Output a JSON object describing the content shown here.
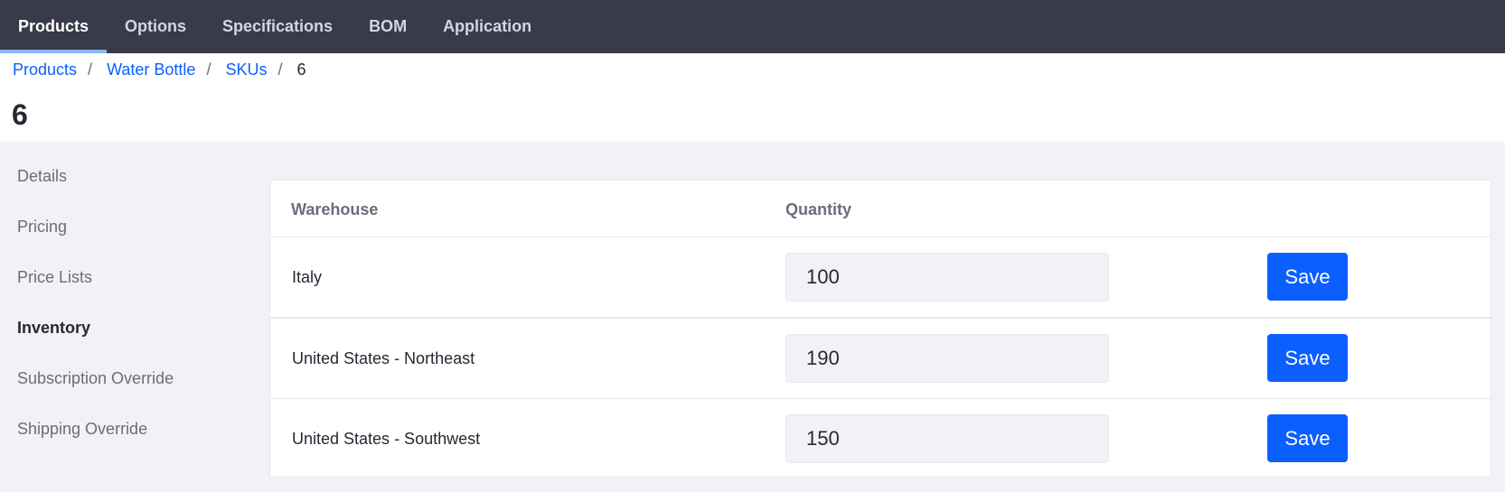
{
  "topnav": {
    "tabs": [
      {
        "label": "Products",
        "active": true
      },
      {
        "label": "Options",
        "active": false
      },
      {
        "label": "Specifications",
        "active": false
      },
      {
        "label": "BOM",
        "active": false
      },
      {
        "label": "Application",
        "active": false
      }
    ]
  },
  "breadcrumb": {
    "items": [
      "Products",
      "Water Bottle",
      "SKUs"
    ],
    "separator": "/",
    "current": "6"
  },
  "page": {
    "title": "6"
  },
  "sidenav": {
    "items": [
      {
        "label": "Details",
        "active": false
      },
      {
        "label": "Pricing",
        "active": false
      },
      {
        "label": "Price Lists",
        "active": false
      },
      {
        "label": "Inventory",
        "active": true
      },
      {
        "label": "Subscription Override",
        "active": false
      },
      {
        "label": "Shipping Override",
        "active": false
      }
    ]
  },
  "inventory": {
    "columns": {
      "warehouse": "Warehouse",
      "quantity": "Quantity"
    },
    "rows": [
      {
        "warehouse": "Italy",
        "quantity": "100",
        "action": "Save"
      },
      {
        "warehouse": "United States - Northeast",
        "quantity": "190",
        "action": "Save"
      },
      {
        "warehouse": "United States - Southwest",
        "quantity": "150",
        "action": "Save"
      }
    ]
  },
  "colors": {
    "topnav_bg": "#393a4a",
    "accent": "#0b5fff",
    "active_tab_indicator": "#8ab4f8",
    "page_bg": "#f1f2f5"
  }
}
